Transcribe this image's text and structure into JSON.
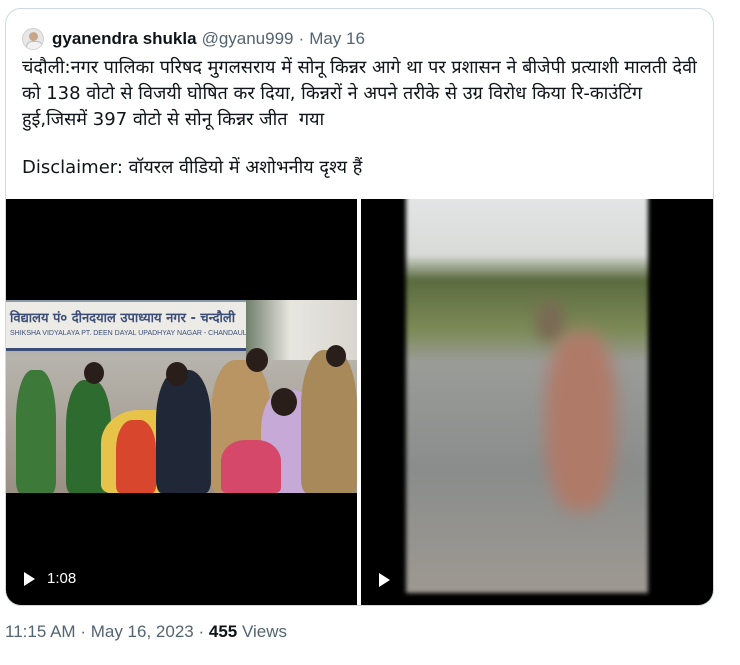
{
  "tweet": {
    "author_name": "gyanendra shukla",
    "handle": "@gyanu999",
    "separator": "·",
    "date": "May 16",
    "text": "चंदौली:नगर पालिका परिषद मुगलसराय में सोनू किन्नर आगे था पर प्रशासन ने बीजेपी प्रत्याशी मालती देवी को 138 वोटो से विजयी घोषित कर दिया, किन्नरों ने अपने तरीके से उग्र विरोध किया रि-काउंटिंग हुई,जिसमें 397 वोटो से सोनू किन्नर जीत  गया",
    "disclaimer": "Disclaimer: वॉयरल वीडियो में अशोभनीय दृश्य हैं"
  },
  "media": {
    "video1": {
      "duration": "1:08",
      "banner_text": "विद्यालय पं० दीनदयाल उपाध्याय नगर - चन्दौली",
      "banner_sub": "SHIKSHA VIDYALAYA PT. DEEN DAYAL UPADHYAY NAGAR - CHANDAULI"
    },
    "video2": {
      "play_icon": "play-icon"
    }
  },
  "footer": {
    "time": "11:15 AM",
    "separator1": "·",
    "date": "May 16, 2023",
    "separator2": "·",
    "views_count": "455",
    "views_label": "Views"
  }
}
